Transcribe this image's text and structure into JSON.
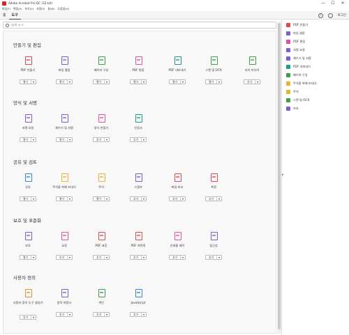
{
  "window": {
    "title": "Adobe Acrobat Pro DC (32-bit)",
    "controls": [
      "—",
      "☐",
      "✕"
    ]
  },
  "menu": [
    "파일(F)",
    "편집(E)",
    "보기(V)",
    "서명(S)",
    "창(W)",
    "도움말(H)"
  ],
  "nav": {
    "tabs": [
      "홈",
      "도구"
    ],
    "help_icon": "question-icon",
    "account_icon": "user-icon",
    "login": "로그인"
  },
  "search": {
    "placeholder": "검색 도구"
  },
  "sections": [
    {
      "title": "만들기 및 편집",
      "tools": [
        {
          "label": "PDF 만들기",
          "button": "열기",
          "icon": "pdf-create-icon",
          "color": "#e34850"
        },
        {
          "label": "파일 결합",
          "button": "열기",
          "icon": "combine-files-icon",
          "color": "#7d5bd0"
        },
        {
          "label": "페이지 구성",
          "button": "열기",
          "icon": "organize-pages-icon",
          "color": "#3ea044"
        },
        {
          "label": "PDF 편집",
          "button": "열기",
          "icon": "edit-pdf-icon",
          "color": "#e3519e"
        },
        {
          "label": "PDF 내보내기",
          "button": "열기",
          "icon": "export-pdf-icon",
          "color": "#1c9a8c"
        },
        {
          "label": "스캔 및 OCR",
          "button": "열기",
          "icon": "scan-ocr-icon",
          "color": "#3ea044"
        },
        {
          "label": "리치 미디어",
          "button": "추가",
          "icon": "rich-media-icon",
          "color": "#3ea044"
        }
      ]
    },
    {
      "title": "양식 및 서명",
      "tools": [
        {
          "label": "서명 요청",
          "button": "열기",
          "icon": "request-signature-icon",
          "color": "#7d5bd0"
        },
        {
          "label": "채우기 및 서명",
          "button": "열기",
          "icon": "fill-sign-icon",
          "color": "#7d5bd0"
        },
        {
          "label": "양식 만들기",
          "button": "추가",
          "icon": "prepare-form-icon",
          "color": "#e3519e"
        },
        {
          "label": "인증서",
          "button": "추가",
          "icon": "certificates-icon",
          "color": "#1c9a8c"
        }
      ]
    },
    {
      "title": "공유 및 검토",
      "tools": [
        {
          "label": "공유",
          "button": "열기",
          "icon": "share-icon",
          "color": "#2d8ae0"
        },
        {
          "label": "주석을 위해 보내기",
          "button": "열기",
          "icon": "send-comments-icon",
          "color": "#e8b32a"
        },
        {
          "label": "주석",
          "button": "열기",
          "icon": "comment-icon",
          "color": "#e8b32a"
        },
        {
          "label": "스탬프",
          "button": "추가",
          "icon": "stamp-icon",
          "color": "#7d5bd0"
        },
        {
          "label": "파일 비교",
          "button": "추가",
          "icon": "compare-files-icon",
          "color": "#e34850"
        },
        {
          "label": "측정",
          "button": "추가",
          "icon": "measure-icon",
          "color": "#e34850"
        }
      ]
    },
    {
      "title": "보호 및 표준화",
      "tools": [
        {
          "label": "보호",
          "button": "열기",
          "icon": "protect-icon",
          "color": "#7d5bd0"
        },
        {
          "label": "교정",
          "button": "추가",
          "icon": "redact-icon",
          "color": "#e3519e"
        },
        {
          "label": "PDF 표준",
          "button": "추가",
          "icon": "pdf-standards-icon",
          "color": "#e34850"
        },
        {
          "label": "PDF 최적화",
          "button": "추가",
          "icon": "optimize-pdf-icon",
          "color": "#e34850"
        },
        {
          "label": "인쇄물 제작",
          "button": "추가",
          "icon": "print-production-icon",
          "color": "#e3519e"
        },
        {
          "label": "접근성",
          "button": "추가",
          "icon": "accessibility-icon",
          "color": "#7d5bd0"
        }
      ]
    },
    {
      "title": "사용자 정의",
      "tools": [
        {
          "label": "사용자 정의 도구 생성기",
          "button": "추가",
          "icon": "custom-tool-icon",
          "color": "#e8902a"
        },
        {
          "label": "동작 마법사",
          "button": "추가",
          "icon": "action-wizard-icon",
          "color": "#7d5bd0"
        },
        {
          "label": "색인",
          "button": "추가",
          "icon": "index-icon",
          "color": "#3ea044"
        },
        {
          "label": "JavaScript",
          "button": "추가",
          "icon": "javascript-icon",
          "color": "#2d8ae0"
        }
      ]
    }
  ],
  "right_pane": [
    {
      "label": "PDF 만들기",
      "icon": "pdf-create-icon",
      "color": "#e34850"
    },
    {
      "label": "파일 결합",
      "icon": "combine-files-icon",
      "color": "#7d5bd0"
    },
    {
      "label": "PDF 편집",
      "icon": "edit-pdf-icon",
      "color": "#e3519e"
    },
    {
      "label": "서명 요청",
      "icon": "request-signature-icon",
      "color": "#7d5bd0"
    },
    {
      "label": "채우기 및 서명",
      "icon": "fill-sign-icon",
      "color": "#7d5bd0"
    },
    {
      "label": "PDF 내보내기",
      "icon": "export-pdf-icon",
      "color": "#1c9a8c"
    },
    {
      "label": "페이지 구성",
      "icon": "organize-pages-icon",
      "color": "#3ea044"
    },
    {
      "label": "주석을 위해 보내기",
      "icon": "send-comments-icon",
      "color": "#e8b32a"
    },
    {
      "label": "주석",
      "icon": "comment-icon",
      "color": "#e8b32a"
    },
    {
      "label": "스캔 및 OCR",
      "icon": "scan-ocr-icon",
      "color": "#3ea044"
    },
    {
      "label": "보호",
      "icon": "protect-icon",
      "color": "#7d5bd0"
    }
  ]
}
